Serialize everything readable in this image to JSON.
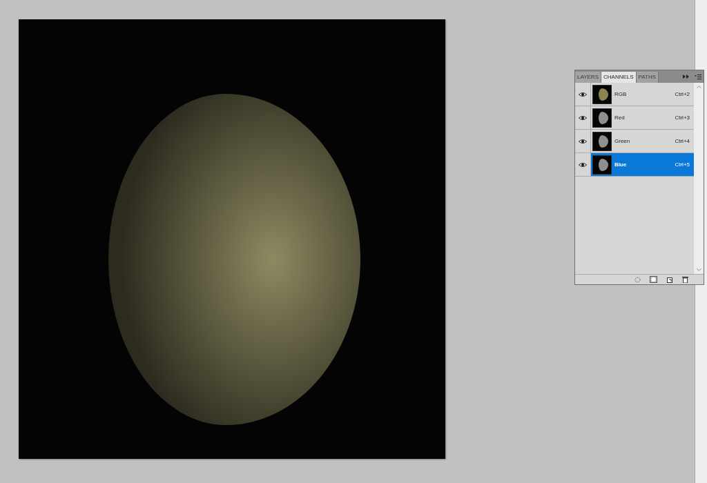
{
  "panel": {
    "tabs": [
      {
        "label": "LAYERS",
        "selected": false
      },
      {
        "label": "CHANNELS",
        "selected": true
      },
      {
        "label": "PATHS",
        "selected": false
      }
    ],
    "channels": [
      {
        "name": "RGB",
        "shortcut": "Ctrl+2",
        "kind": "composite",
        "visible": true,
        "selected": false
      },
      {
        "name": "Red",
        "shortcut": "Ctrl+3",
        "kind": "single",
        "visible": true,
        "selected": false
      },
      {
        "name": "Green",
        "shortcut": "Ctrl+4",
        "kind": "single",
        "visible": true,
        "selected": false
      },
      {
        "name": "Blue",
        "shortcut": "Ctrl+5",
        "kind": "single",
        "visible": true,
        "selected": true
      }
    ]
  }
}
